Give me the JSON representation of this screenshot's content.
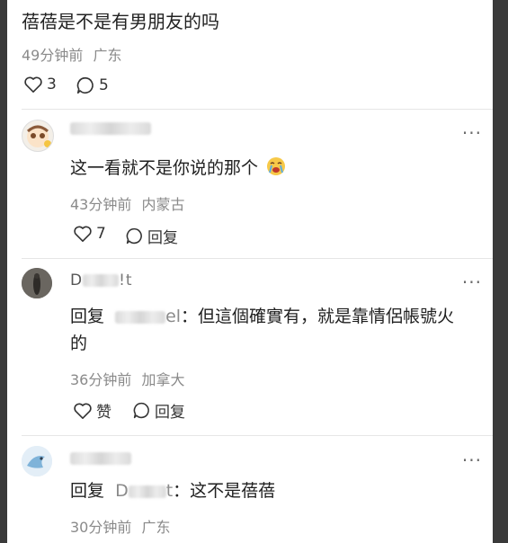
{
  "post": {
    "text": "蓓蓓是不是有男朋友的吗",
    "time": "49分钟前",
    "location": "广东",
    "likes": "3",
    "comments": "5"
  },
  "comments": [
    {
      "text": "这一看就不是你说的那个",
      "time": "43分钟前",
      "location": "内蒙古",
      "likes": "7",
      "reply_label": "回复"
    },
    {
      "username_suffix": "!t",
      "reply_prefix": "回复",
      "reply_target_suffix": "el",
      "text": "：但這個確實有，就是靠情侶帳號火的",
      "time": "36分钟前",
      "location": "加拿大",
      "like_label": "赞",
      "reply_label": "回复"
    },
    {
      "reply_prefix": "回复",
      "reply_target_prefix": "D",
      "reply_target_suffix": "t",
      "text": "：这不是蓓蓓",
      "time": "30分钟前",
      "location": "广东"
    }
  ],
  "more_label": "···"
}
